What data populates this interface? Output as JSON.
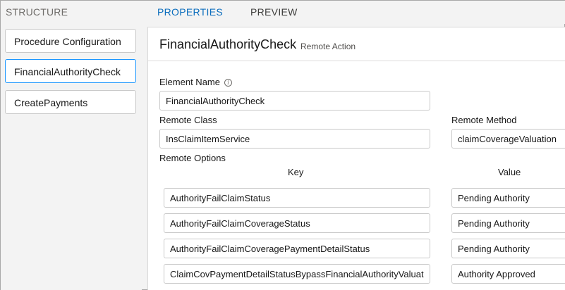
{
  "header": {
    "structure_title": "STRUCTURE",
    "tabs": [
      {
        "label": "PROPERTIES",
        "active": true
      },
      {
        "label": "PREVIEW",
        "active": false
      }
    ]
  },
  "structure": {
    "items": [
      {
        "label": "Procedure Configuration",
        "selected": false
      },
      {
        "label": "FinancialAuthorityCheck",
        "selected": true
      },
      {
        "label": "CreatePayments",
        "selected": false
      }
    ]
  },
  "properties": {
    "title": "FinancialAuthorityCheck",
    "type": "Remote Action",
    "element_name": {
      "label": "Element Name",
      "value": "FinancialAuthorityCheck"
    },
    "remote_class": {
      "label": "Remote Class",
      "value": "InsClaimItemService"
    },
    "remote_method": {
      "label": "Remote Method",
      "value": "claimCoverageValuation"
    },
    "remote_options": {
      "label": "Remote Options",
      "key_header": "Key",
      "value_header": "Value",
      "rows": [
        {
          "key": "AuthorityFailClaimStatus",
          "value": "Pending Authority"
        },
        {
          "key": "AuthorityFailClaimCoverageStatus",
          "value": "Pending Authority"
        },
        {
          "key": "AuthorityFailClaimCoveragePaymentDetailStatus",
          "value": "Pending Authority"
        },
        {
          "key": "ClaimCovPaymentDetailStatusBypassFinancialAuthorityValuation",
          "value": "Authority Approved"
        }
      ]
    }
  },
  "colors": {
    "accent": "#0b6dbd",
    "selected_border": "#1b96ff",
    "input_border": "#c9c9c9"
  }
}
